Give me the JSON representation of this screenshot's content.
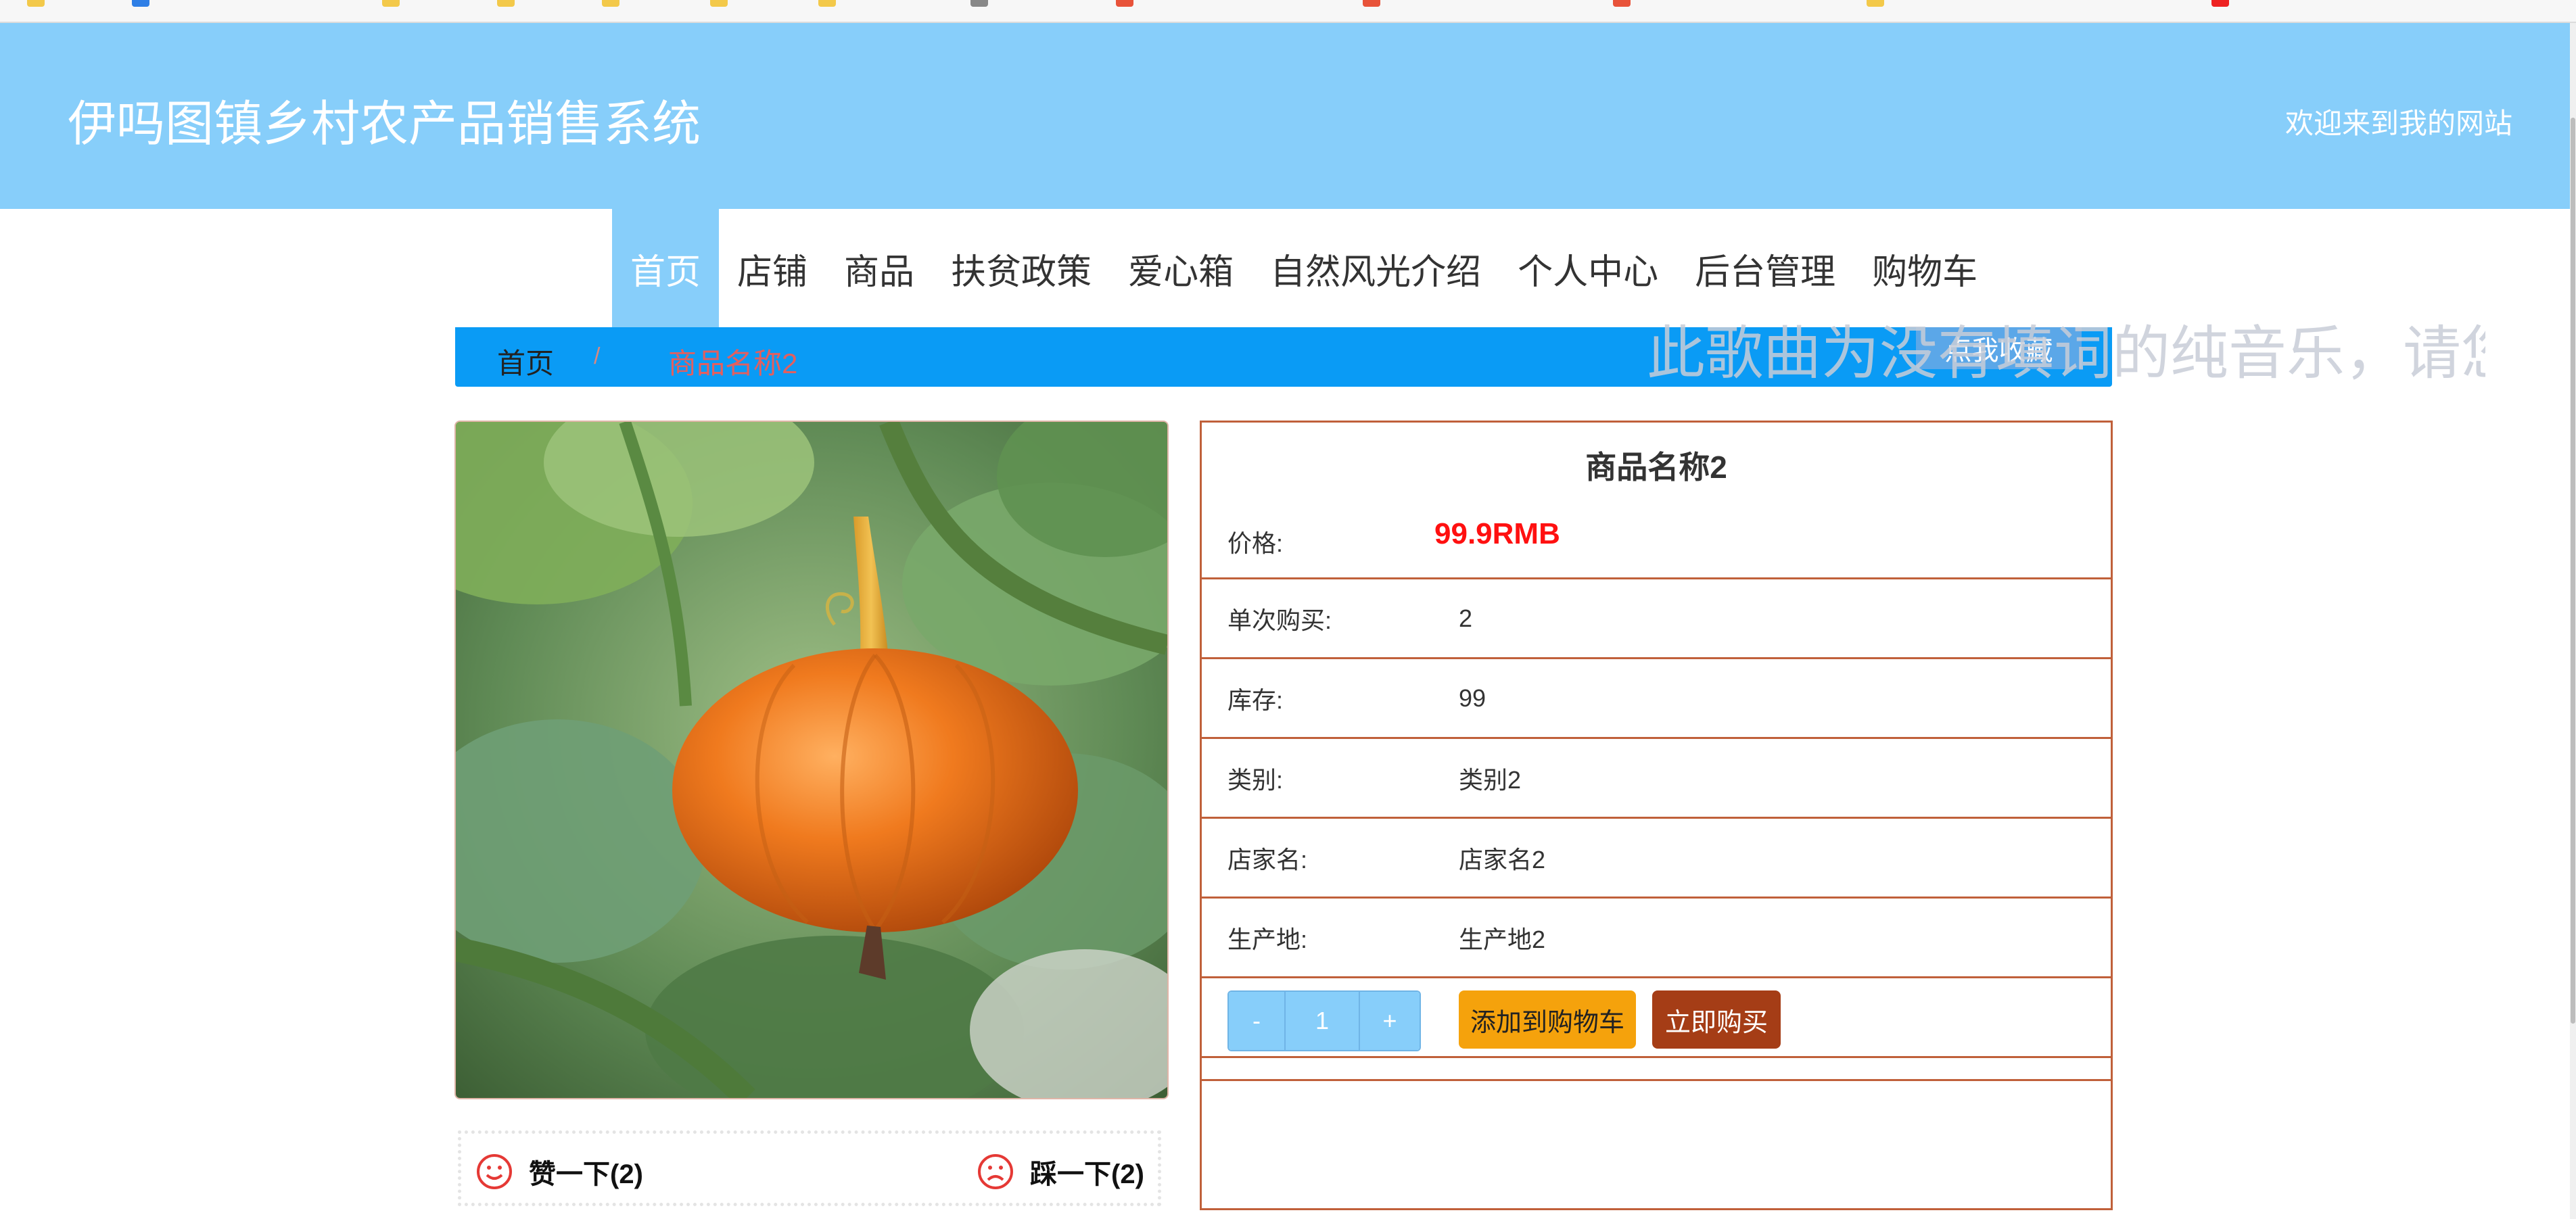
{
  "header": {
    "title": "伊吗图镇乡村农产品销售系统",
    "welcome": "欢迎来到我的网站"
  },
  "nav": {
    "items": [
      {
        "label": "首页"
      },
      {
        "label": "店铺"
      },
      {
        "label": "商品"
      },
      {
        "label": "扶贫政策"
      },
      {
        "label": "爱心箱"
      },
      {
        "label": "自然风光介绍"
      },
      {
        "label": "个人中心"
      },
      {
        "label": "后台管理"
      },
      {
        "label": "购物车"
      }
    ],
    "active": "首页"
  },
  "breadcrumb": {
    "home": "首页",
    "separator": "/",
    "current": "商品名称2",
    "favorite_label": "点我收藏",
    "marquee": "此歌曲为没有填词的纯音乐，请您"
  },
  "product": {
    "image_alt": "pumpkin",
    "title": "商品名称2",
    "price_label": "价格:",
    "price": "99.9RMB",
    "rows": [
      {
        "label": "单次购买:",
        "value": "2"
      },
      {
        "label": "库存:",
        "value": "99"
      },
      {
        "label": "类别:",
        "value": "类别2"
      },
      {
        "label": "店家名:",
        "value": "店家名2"
      },
      {
        "label": "生产地:",
        "value": "生产地2"
      }
    ],
    "quantity": {
      "minus": "-",
      "value": "1",
      "plus": "+"
    },
    "add_to_cart": "添加到购物车",
    "buy_now": "立即购买"
  },
  "votes": {
    "like": "赞一下(2)",
    "dislike": "踩一下(2)"
  },
  "colors": {
    "header_bg": "#87cefa",
    "breadcrumb_bg": "#0a9bf5",
    "price": "#ff1010",
    "border": "#c0603a",
    "cart_button": "#f5a20c",
    "buy_button": "#a53d16"
  }
}
